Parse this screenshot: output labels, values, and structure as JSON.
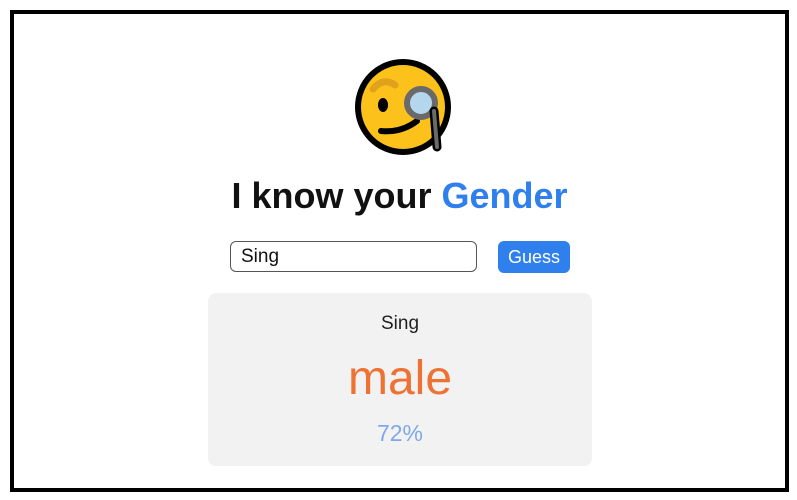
{
  "header": {
    "icon": "face-with-monocle-icon",
    "title_prefix": "I know your ",
    "title_accent": "Gender"
  },
  "form": {
    "name_value": "Sing",
    "guess_label": "Guess"
  },
  "result": {
    "name": "Sing",
    "gender": "male",
    "probability": "72%"
  },
  "colors": {
    "accent": "#2f80ed",
    "gender": "#ee7233",
    "probability": "#7fa8ea",
    "card_background": "#f2f2f2"
  }
}
